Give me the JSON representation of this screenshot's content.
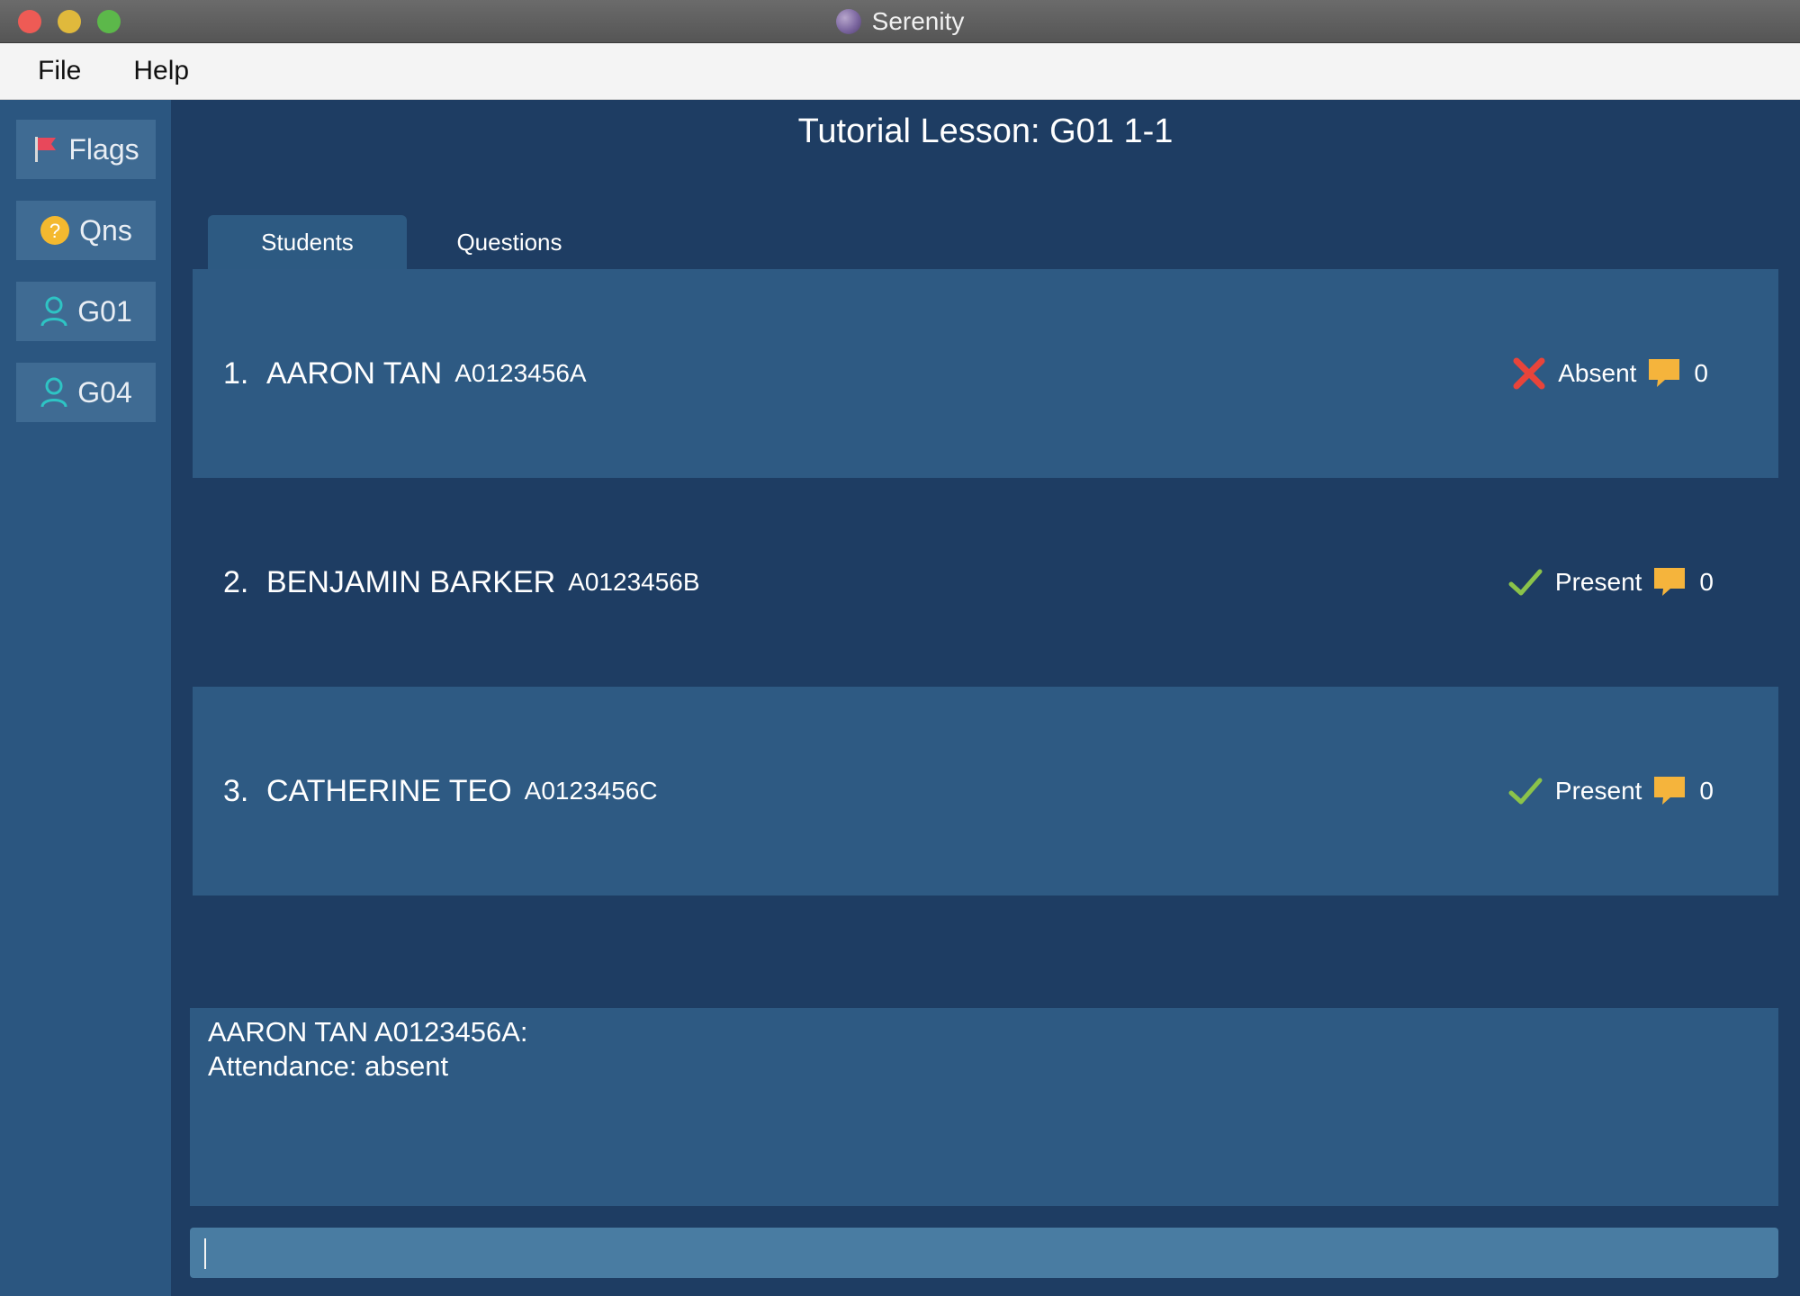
{
  "window": {
    "title": "Serenity"
  },
  "menu": {
    "items": [
      "File",
      "Help"
    ]
  },
  "sidebar": {
    "buttons": [
      {
        "label": "Flags",
        "icon": "flag-icon"
      },
      {
        "label": "Qns",
        "icon": "question-icon"
      },
      {
        "label": "G01",
        "icon": "user-icon"
      },
      {
        "label": "G04",
        "icon": "user-icon"
      }
    ]
  },
  "main": {
    "title": "Tutorial Lesson: G01 1-1",
    "tabs": [
      {
        "label": "Students",
        "active": true
      },
      {
        "label": "Questions",
        "active": false
      }
    ],
    "students": [
      {
        "index": "1.",
        "name": "AARON TAN",
        "id": "A0123456A",
        "status": "Absent",
        "status_icon": "cross-icon",
        "participation": "0"
      },
      {
        "index": "2.",
        "name": "BENJAMIN BARKER",
        "id": "A0123456B",
        "status": "Present",
        "status_icon": "check-icon",
        "participation": "0"
      },
      {
        "index": "3.",
        "name": "CATHERINE TEO",
        "id": "A0123456C",
        "status": "Present",
        "status_icon": "check-icon",
        "participation": "0"
      }
    ],
    "details": {
      "line1": "AARON TAN A0123456A:",
      "line2": "Attendance:  absent"
    },
    "command_input": {
      "value": "",
      "placeholder": ""
    }
  },
  "colors": {
    "background": "#1e3d63",
    "row_light": "#2e5a83",
    "sidebar_button": "#3f6b93",
    "absent_red": "#e8443a",
    "present_green": "#8bc34a",
    "bubble_orange": "#f5b43c",
    "user_icon_teal": "#2ec4c4"
  }
}
